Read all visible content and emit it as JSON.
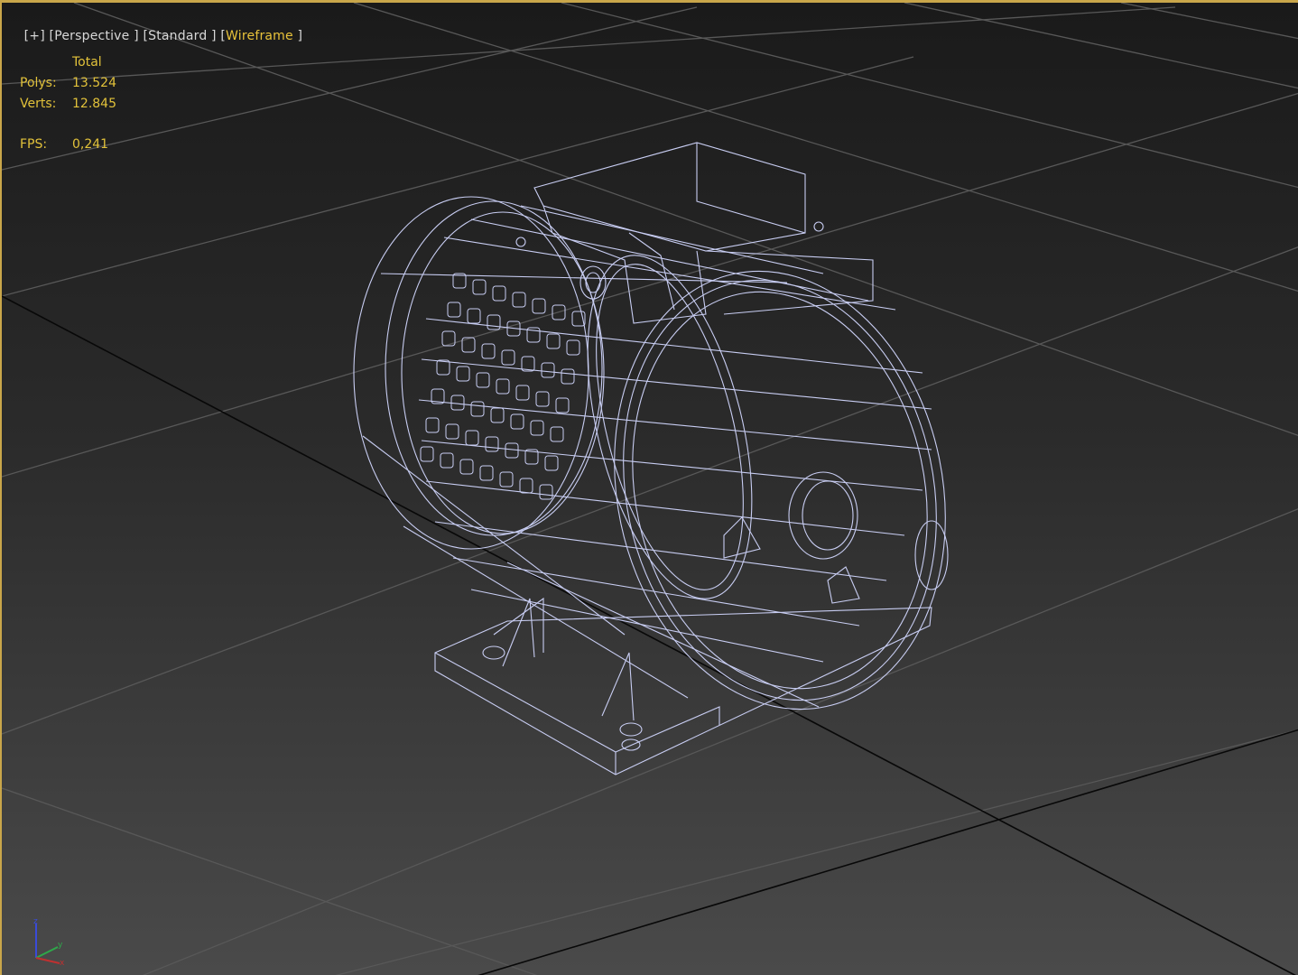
{
  "viewport": {
    "labels": {
      "plus": "+",
      "perspective": "Perspective",
      "standard": "Standard",
      "wireframe": "Wireframe"
    },
    "stats": {
      "header": "Total",
      "polys_label": "Polys:",
      "polys_value": "13.524",
      "verts_label": "Verts:",
      "verts_value": "12.845",
      "fps_label": "FPS:",
      "fps_value": "0,241"
    },
    "axis": {
      "z": "z",
      "y": "y",
      "x": "x"
    },
    "colors": {
      "border": "#c9a64a",
      "stats_text": "#e2c23a",
      "wire": "#c8cdf2",
      "grid": "#555555",
      "grid_axis": "#000000"
    }
  }
}
